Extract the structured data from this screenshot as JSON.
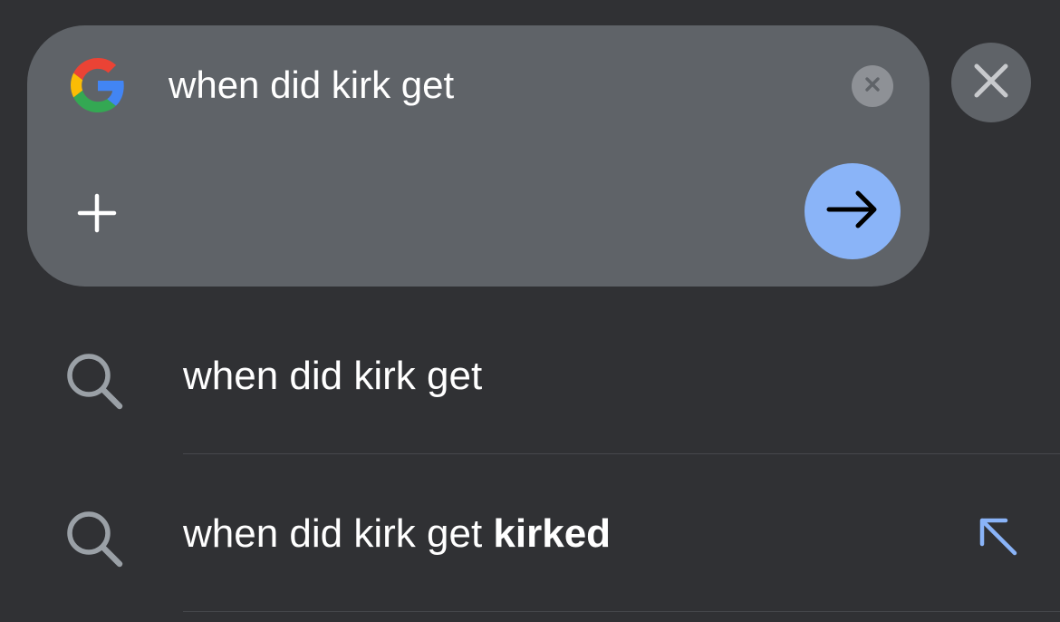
{
  "search_bar": {
    "query": "when did kirk get",
    "logo": "google-g-logo",
    "clear_icon": "close-small-icon",
    "add_icon": "plus-icon",
    "submit_icon": "arrow-right-icon"
  },
  "close_button": {
    "icon": "close-icon"
  },
  "suggestions": [
    {
      "text": "when did kirk get",
      "completion": "",
      "icon": "search-icon"
    },
    {
      "text": "when did kirk get ",
      "completion": "kirked",
      "icon": "search-icon",
      "action_icon": "arrow-up-left-icon"
    }
  ],
  "colors": {
    "background": "#303134",
    "search_card": "#5f6368",
    "accent_blue": "#8ab4f8",
    "text": "#ffffff",
    "icon_gray": "#9aa0a6"
  }
}
